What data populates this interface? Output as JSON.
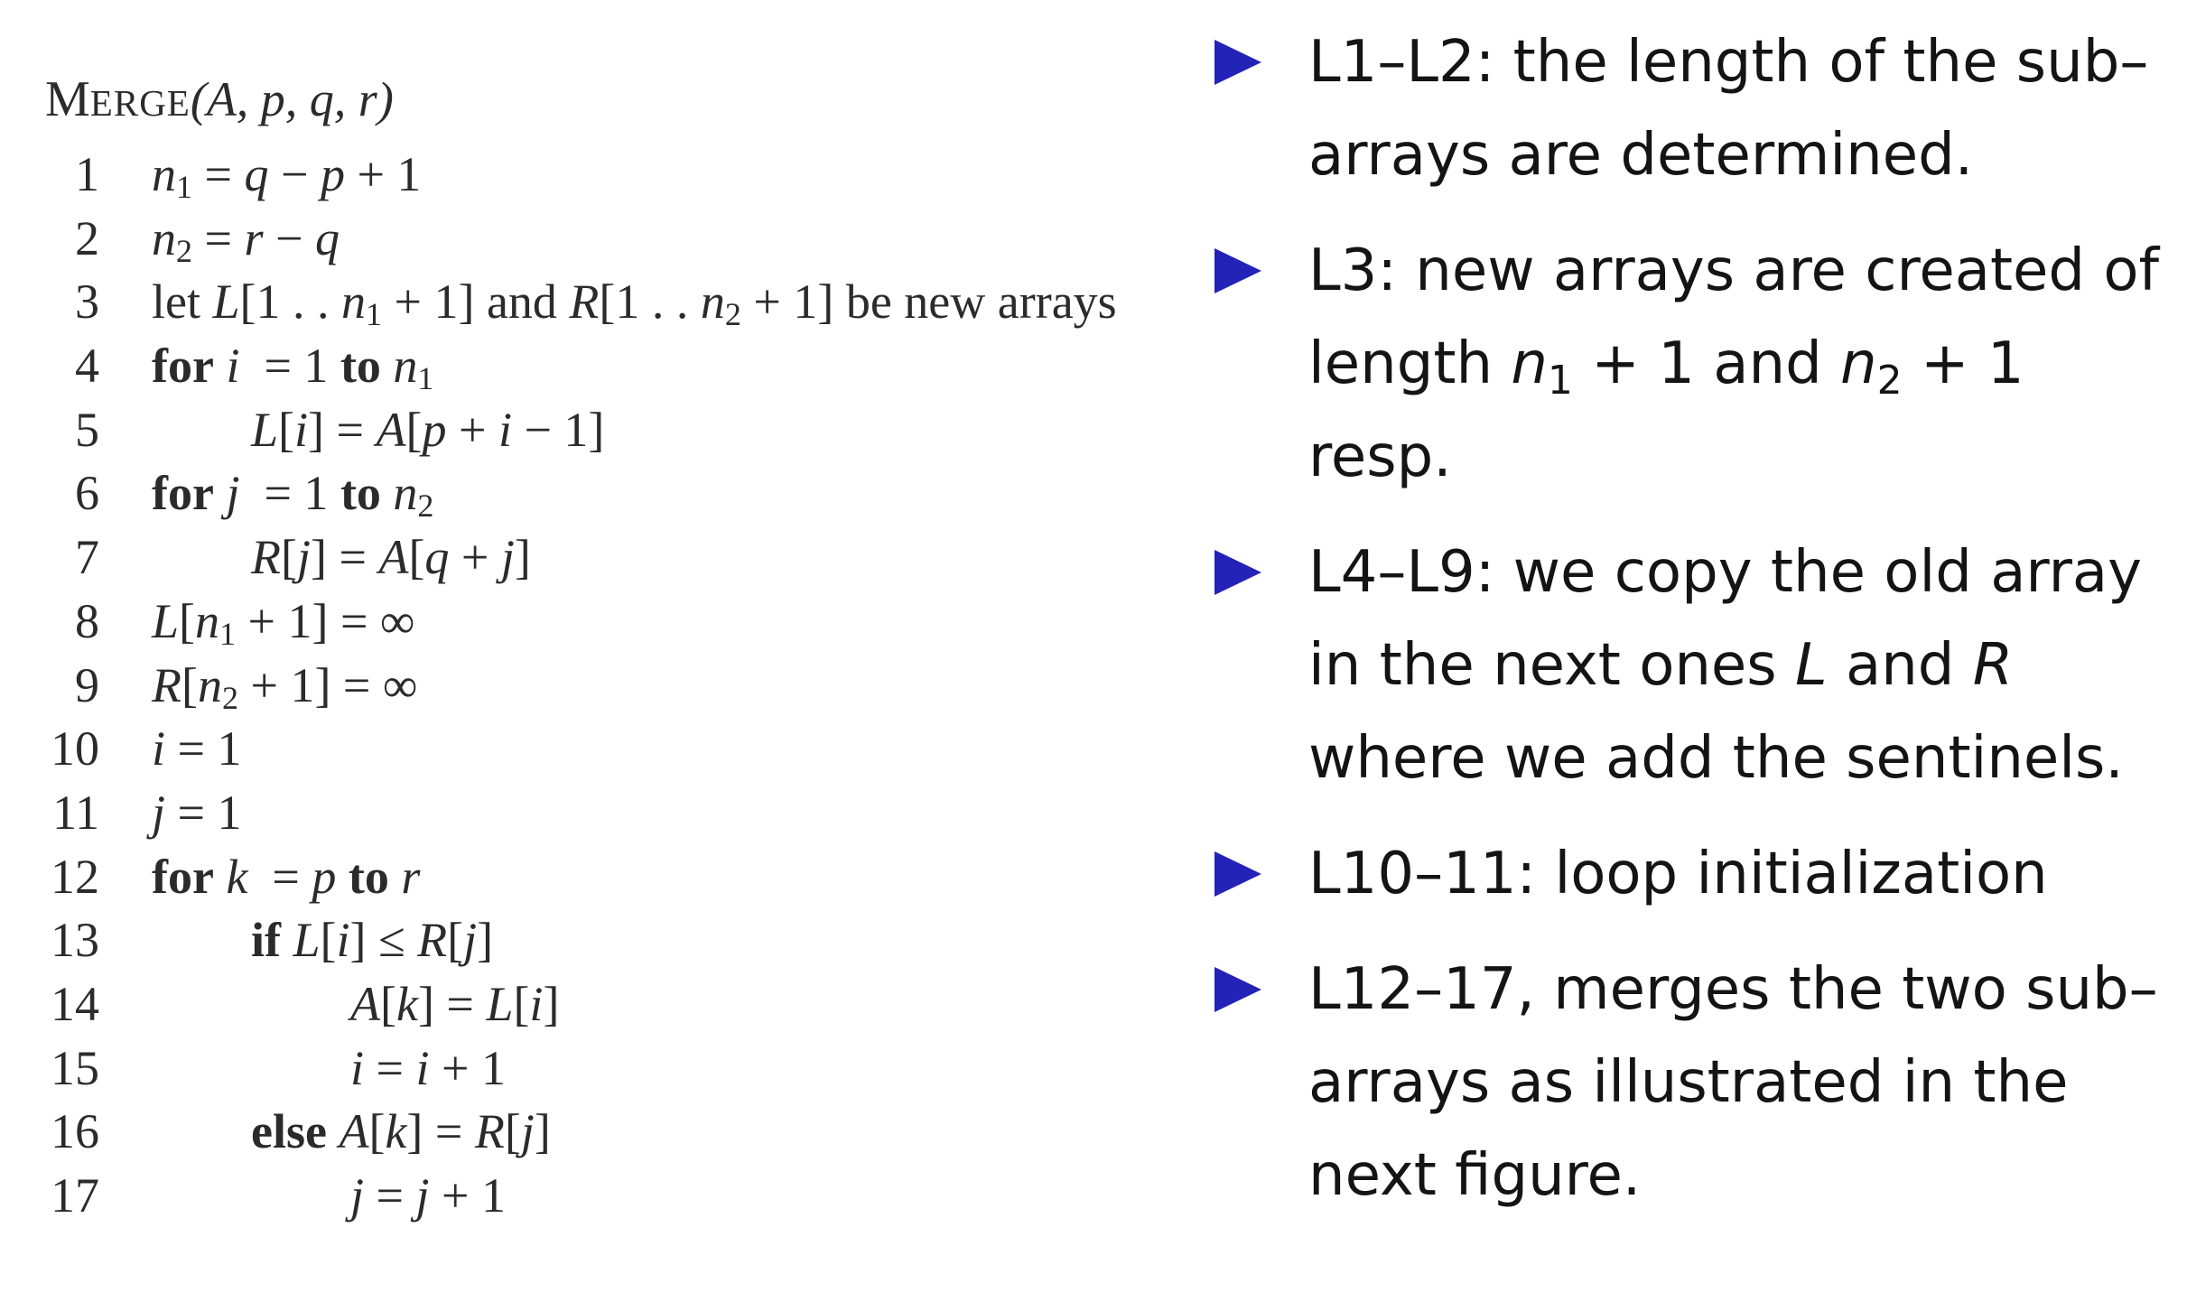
{
  "procedure": {
    "name_first": "M",
    "name_rest": "ERGE",
    "params": "(A, p, q, r)"
  },
  "code": {
    "lines": [
      {
        "num": "1"
      },
      {
        "num": "2"
      },
      {
        "num": "3"
      },
      {
        "num": "4"
      },
      {
        "num": "5"
      },
      {
        "num": "6"
      },
      {
        "num": "7"
      },
      {
        "num": "8"
      },
      {
        "num": "9"
      },
      {
        "num": "10"
      },
      {
        "num": "11"
      },
      {
        "num": "12"
      },
      {
        "num": "13"
      },
      {
        "num": "14"
      },
      {
        "num": "15"
      },
      {
        "num": "16"
      },
      {
        "num": "17"
      }
    ],
    "text": {
      "l3_prefix": "let ",
      "l3_and": " and ",
      "l3_suffix": " be new arrays",
      "kw_for": "for",
      "kw_to": "to",
      "kw_if": "if",
      "kw_else": "else"
    }
  },
  "notes": {
    "bullets": [
      {
        "text": "L1–L2: the length of the sub–arrays are determined."
      },
      {
        "part1": "L3: new arrays are created of length ",
        "math1": "n",
        "sub1": "1",
        "mid1": " + 1 and ",
        "math2": "n",
        "sub2": "2",
        "end": " + 1 resp."
      },
      {
        "part1": "L4–L9: we copy the old array in the next ones ",
        "var1": "L",
        "mid": " and ",
        "var2": "R",
        "end": " where we add the sentinels."
      },
      {
        "text": "L10–11: loop initialization"
      },
      {
        "text": "L12–17, merges the two sub–arrays as illustrated in the next figure."
      }
    ],
    "bullet_color": "#2323b8"
  }
}
